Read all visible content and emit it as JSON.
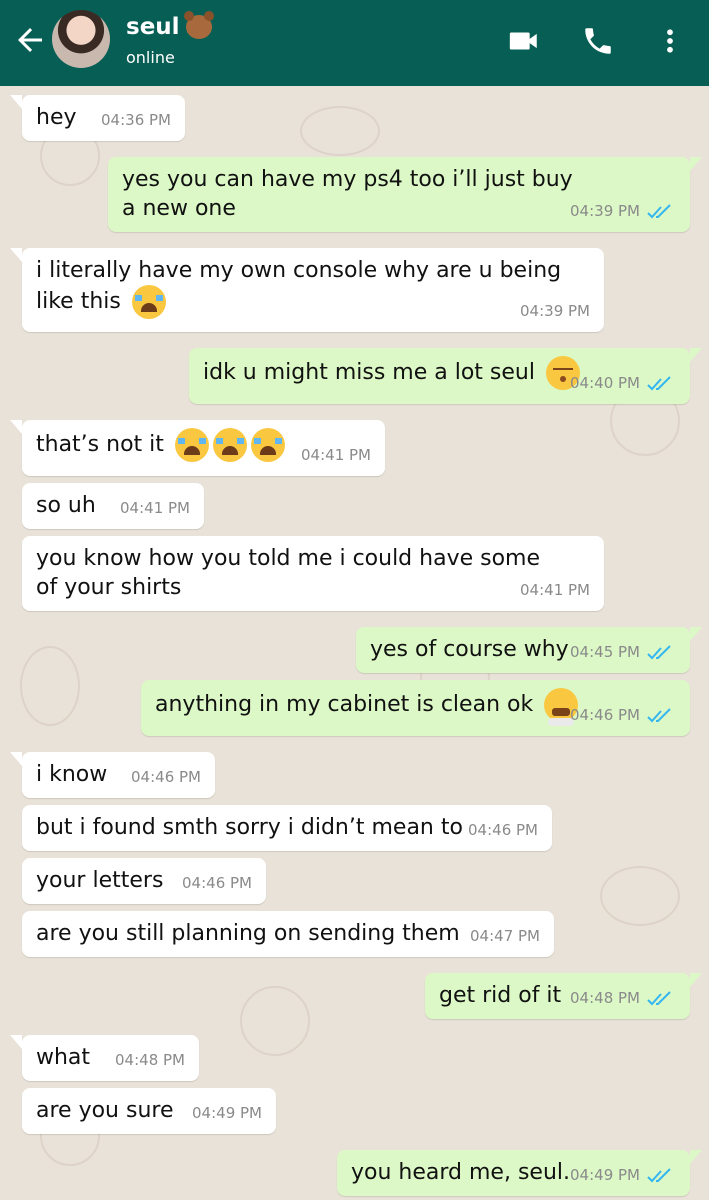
{
  "header": {
    "contact_name": "seul",
    "status": "online",
    "name_emoji": "bear-face-emoji",
    "colors": {
      "bar": "#075e54",
      "incoming": "#ffffff",
      "outgoing": "#dcf8c6",
      "read_ticks": "#34b7f1"
    }
  },
  "messages": [
    {
      "dir": "in",
      "text": "hey",
      "time": "04:36 PM"
    },
    {
      "dir": "out",
      "text": "yes you can have my ps4 too i’ll just buy a new one",
      "time": "04:39 PM",
      "read": true
    },
    {
      "dir": "in",
      "text": "i literally have my own console why are u being like this",
      "emoji": "loudly-crying-face",
      "time": "04:39 PM"
    },
    {
      "dir": "out",
      "text": "idk u might miss me a lot seul",
      "emoji": "kissing-face-smiling-eyes",
      "time": "04:40 PM",
      "read": true
    },
    {
      "dir": "in",
      "text": "that’s not it",
      "emoji": "loudly-crying-face x3",
      "time": "04:41 PM"
    },
    {
      "dir": "in",
      "text": "so uh",
      "time": "04:41 PM"
    },
    {
      "dir": "in",
      "text": "you know how you told me i could have some of your shirts",
      "time": "04:41 PM"
    },
    {
      "dir": "out",
      "text": "yes of course why",
      "time": "04:45 PM",
      "read": true
    },
    {
      "dir": "out",
      "text": "anything in my cabinet is clean ok",
      "emoji": "face-with-steam-from-nose",
      "time": "04:46 PM",
      "read": true
    },
    {
      "dir": "in",
      "text": "i know",
      "time": "04:46 PM"
    },
    {
      "dir": "in",
      "text": "but i found smth sorry i didn’t mean to",
      "time": "04:46 PM"
    },
    {
      "dir": "in",
      "text": "your letters",
      "time": "04:46 PM"
    },
    {
      "dir": "in",
      "text": "are you still planning on sending them",
      "time": "04:47 PM"
    },
    {
      "dir": "out",
      "text": "get rid of it",
      "time": "04:48 PM",
      "read": true
    },
    {
      "dir": "in",
      "text": "what",
      "time": "04:48 PM"
    },
    {
      "dir": "in",
      "text": "are you sure",
      "time": "04:49 PM"
    },
    {
      "dir": "out",
      "text": "you heard me, seul.",
      "time": "04:49 PM",
      "read": true
    }
  ]
}
